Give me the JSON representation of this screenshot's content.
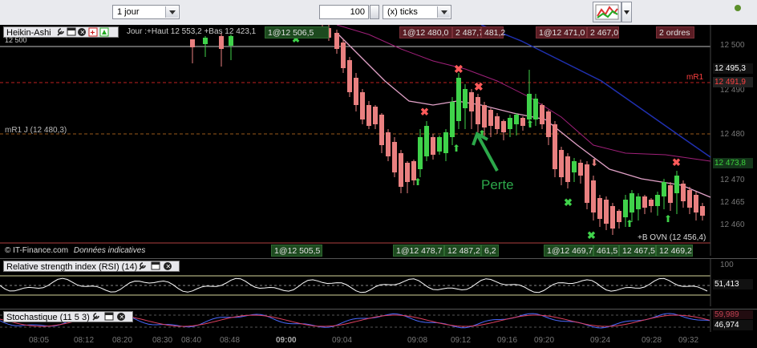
{
  "toolbar": {
    "period_value": "1 jour",
    "units_value": "100",
    "units_type_value": "(x) ticks"
  },
  "price_panel": {
    "title": "Heikin-Ashi",
    "info_text": "Jour :+Haut 12 553,2 +Bas 12 423,1",
    "left_level_label": "12 500",
    "mr1j_label": "mR1 J (12 480,3)",
    "mr1_label": "mR1",
    "credit": "© IT-Finance.com",
    "credit_note": "Données indicatives",
    "ovn_label": "+B OVN (12 456,4)",
    "annotation": "Perte",
    "y_ticks": [
      "12 500",
      "12 490",
      "12 480",
      "12 470",
      "12 465",
      "12 460"
    ],
    "price_tags": [
      {
        "text": "12 495,3",
        "color": "#ffffff",
        "bg": "#111111"
      },
      {
        "text": "12 491,9",
        "color": "#ff4040",
        "bg": "#222222"
      },
      {
        "text": "12 473,8",
        "color": "#3cd23c",
        "bg": "#14361a"
      }
    ],
    "top_orders": [
      {
        "text": "1@12 506,5"
      },
      {
        "text": "1@12 480,0"
      },
      {
        "text": "2 487,7"
      },
      {
        "text": "481,2"
      },
      {
        "text": "1@12 471,0"
      },
      {
        "text": "2 467,0"
      },
      {
        "text": "2 ordres"
      }
    ],
    "bottom_orders": [
      {
        "text": "1@12 505,5"
      },
      {
        "text": "1@12 478,7"
      },
      {
        "text": "12 487,2"
      },
      {
        "text": "6,2"
      },
      {
        "text": "1@12 469,7"
      },
      {
        "text": "461,5"
      },
      {
        "text": "12 467,5"
      },
      {
        "text": "12 469,2"
      }
    ]
  },
  "rsi_panel": {
    "title": "Relative strength index (RSI) (14)",
    "scale_label": "100",
    "value_label": "51,413"
  },
  "stoch_panel": {
    "title": "Stochastique (11 5 3)",
    "value_label": "46,974",
    "hidden_value": "59,989"
  },
  "x_axis": [
    "08:05",
    "08:12",
    "08:20",
    "08:30",
    "08:40",
    "08:48",
    "09:00",
    "09:04",
    "09:08",
    "09:12",
    "09:16",
    "09:20",
    "09:24",
    "09:28",
    "09:32"
  ],
  "colors": {
    "bull": "#3fd24a",
    "bear": "#e98080",
    "accent_green": "#2ca84a"
  }
}
